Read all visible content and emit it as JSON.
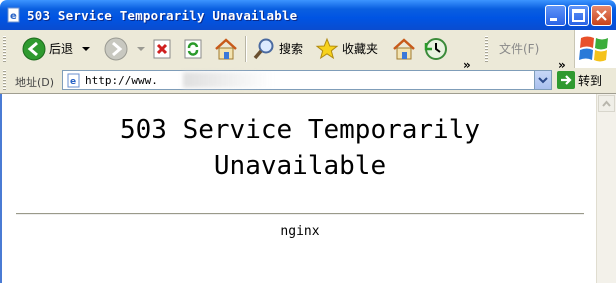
{
  "window": {
    "title": "503 Service Temporarily Unavailable"
  },
  "toolbar": {
    "back_label": "后退",
    "search_label": "搜索",
    "favorites_label": "收藏夹",
    "file_label": "文件(F)",
    "more": "»"
  },
  "address": {
    "label": "地址(D)",
    "url": "http://www.",
    "go_label": "转到"
  },
  "page": {
    "heading_line1": "503 Service Temporarily",
    "heading_line2": "Unavailable",
    "server": "nginx"
  }
}
